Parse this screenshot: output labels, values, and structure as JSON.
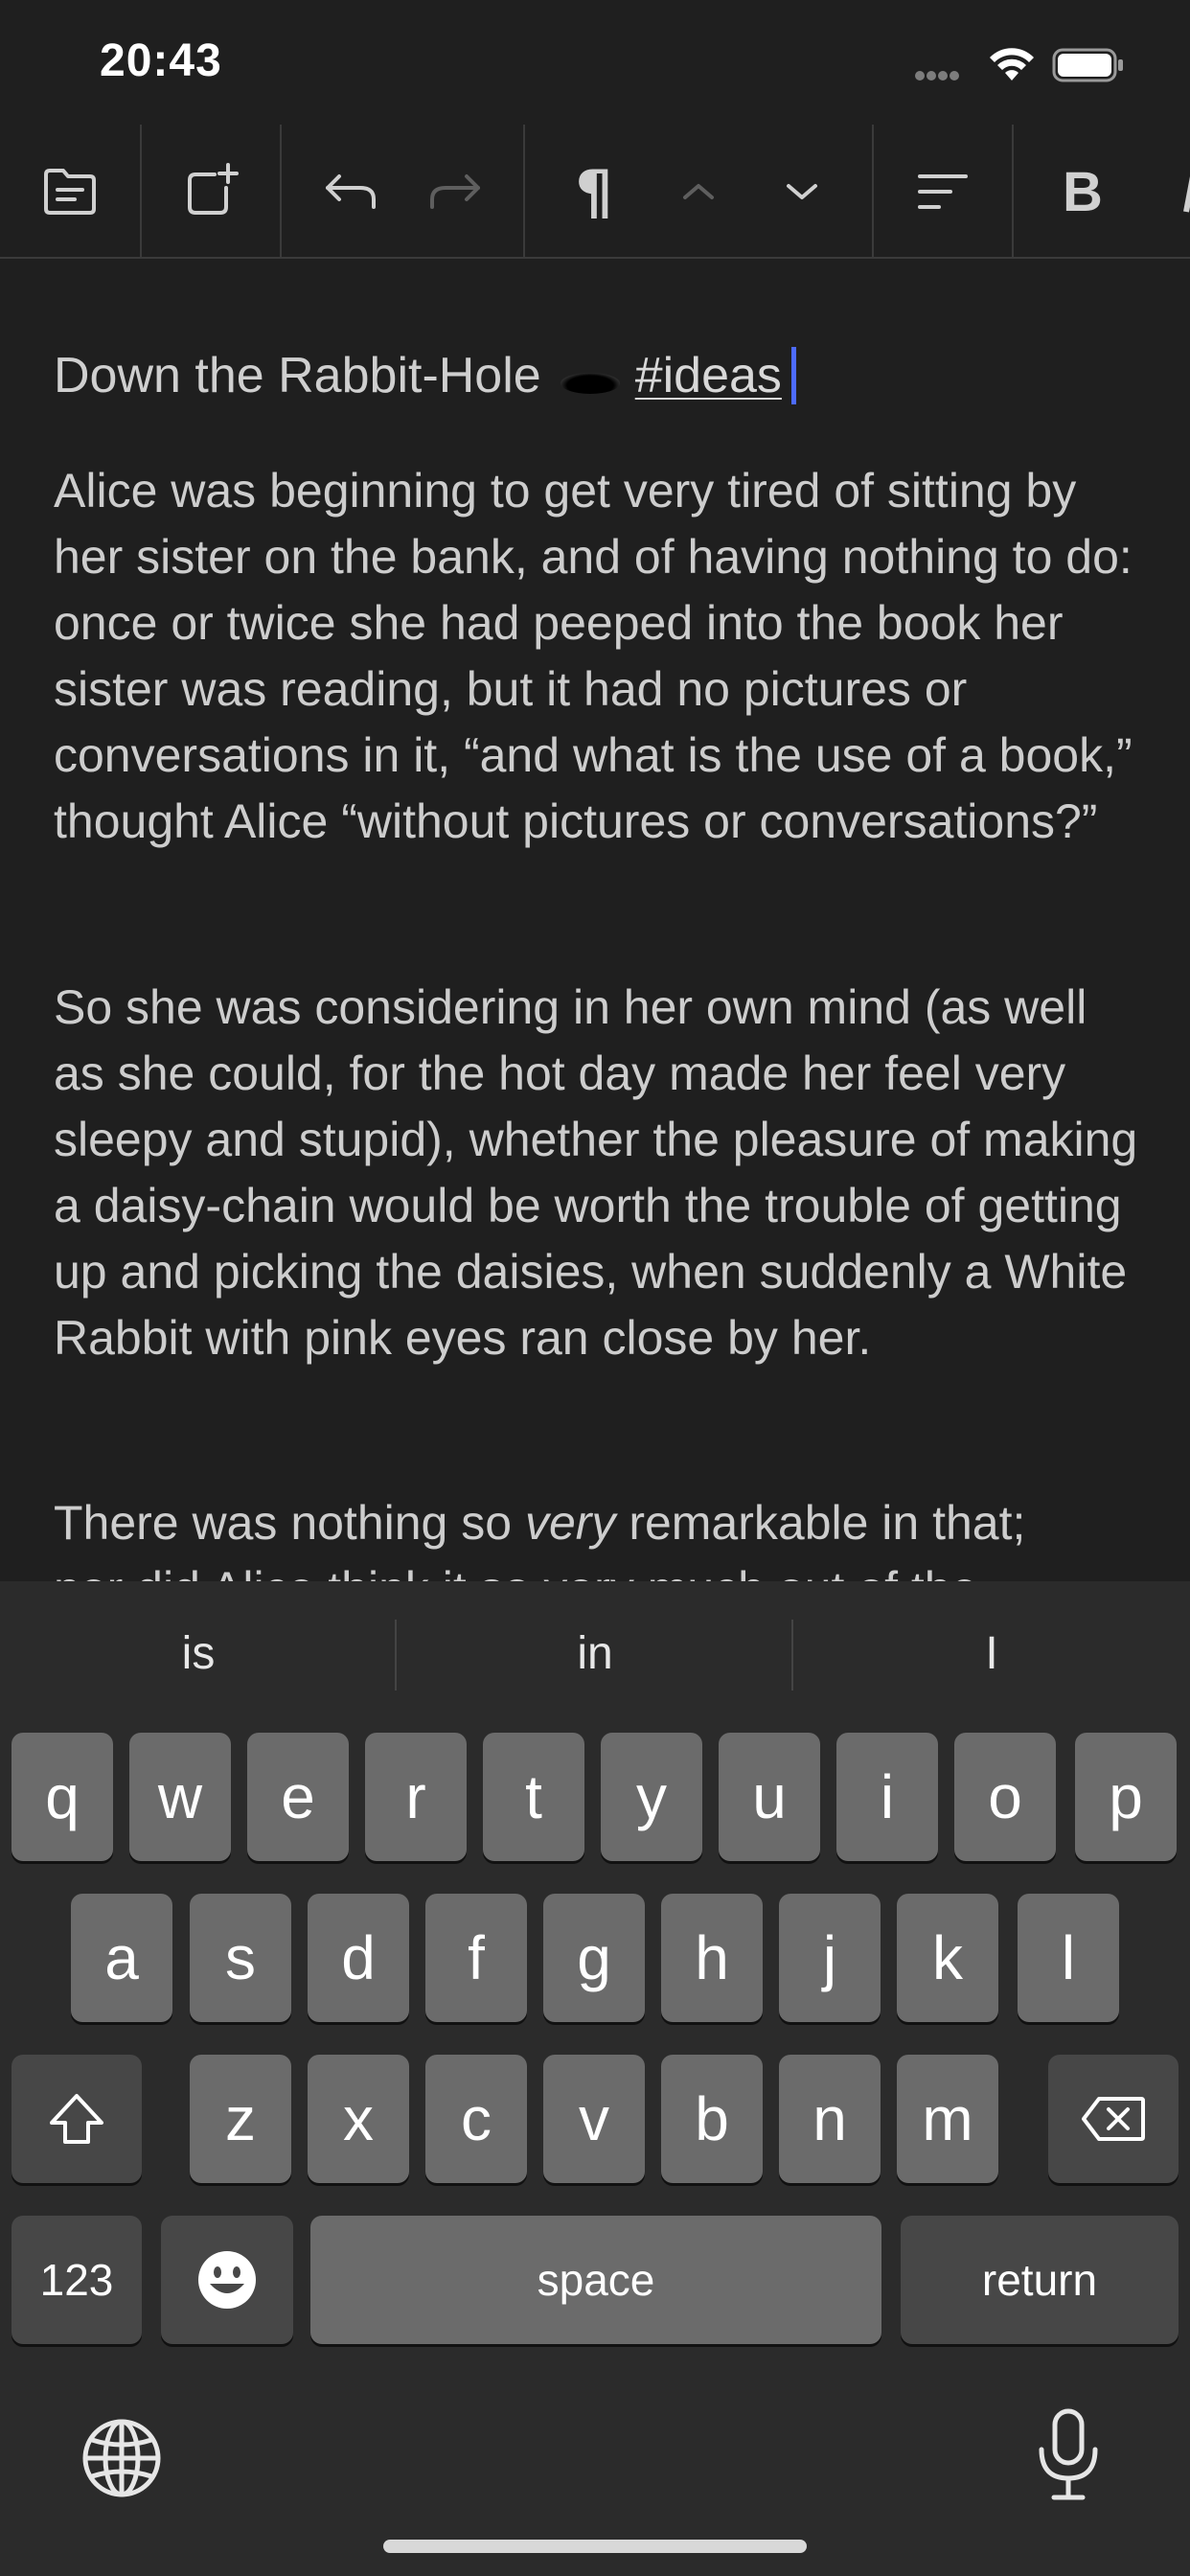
{
  "status_bar": {
    "time": "20:43"
  },
  "toolbar": {
    "icons": [
      "files-icon",
      "new-note-icon",
      "undo-icon",
      "redo-icon",
      "paragraph-icon",
      "move-up-icon",
      "move-down-icon",
      "align-icon",
      "bold-icon"
    ],
    "paragraph_glyph": "¶",
    "bold_glyph": "B"
  },
  "document": {
    "title": "Down the Rabbit-Hole",
    "tag": "#ideas",
    "paragraphs": [
      "Alice was beginning to get very tired of sitting by her sister on the bank, and of having nothing to do: once or twice she had peeped into the book her sister was reading, but it had no pictures or conversations in it, “and what is the use of a book,” thought Alice “without pictures or conversations?”",
      "So she was considering in her own mind (as well as she could, for the hot day made her feel very sleepy and stupid), whether the pleasure of making a daisy-chain would be worth the trouble of getting up and picking the daisies, when suddenly a White Rabbit with pink eyes ran close by her."
    ],
    "paragraph3": {
      "before": "There was nothing so ",
      "emphasis": "very",
      "after": " remarkable in that;",
      "next_line": "nor did Alice think it so very much out of the"
    }
  },
  "keyboard": {
    "suggestions": [
      "is",
      "in",
      "I"
    ],
    "row1": [
      "q",
      "w",
      "e",
      "r",
      "t",
      "y",
      "u",
      "i",
      "o",
      "p"
    ],
    "row2": [
      "a",
      "s",
      "d",
      "f",
      "g",
      "h",
      "j",
      "k",
      "l"
    ],
    "row3": [
      "z",
      "x",
      "c",
      "v",
      "b",
      "n",
      "m"
    ],
    "numbers_label": "123",
    "space_label": "space",
    "return_label": "return"
  },
  "colors": {
    "background": "#1f1f1f",
    "keyboard": "#2b2b2b",
    "key": "#6b6b6b",
    "cursor": "#4d6bff"
  }
}
